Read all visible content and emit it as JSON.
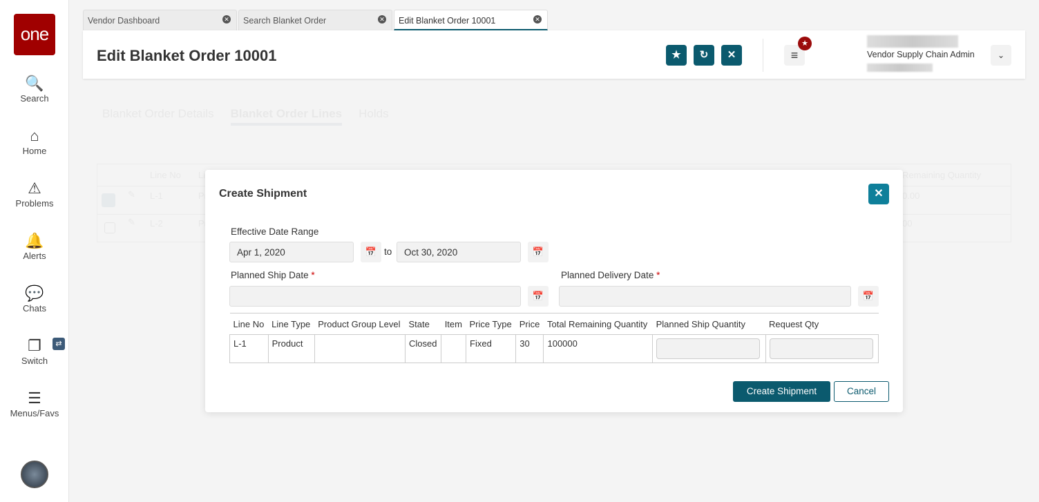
{
  "sidebar": {
    "logo": "one",
    "items": [
      {
        "label": "Search",
        "icon": "search-icon"
      },
      {
        "label": "Home",
        "icon": "home-icon"
      },
      {
        "label": "Problems",
        "icon": "warning-icon"
      },
      {
        "label": "Alerts",
        "icon": "bell-icon"
      },
      {
        "label": "Chats",
        "icon": "chat-icon"
      },
      {
        "label": "Switch",
        "icon": "switch-icon"
      },
      {
        "label": "Menus/Favs",
        "icon": "menu-icon"
      }
    ]
  },
  "tabs": [
    {
      "label": "Vendor Dashboard"
    },
    {
      "label": "Search Blanket Order"
    },
    {
      "label": "Edit Blanket Order 10001",
      "active": true
    }
  ],
  "header": {
    "title": "Edit Blanket Order 10001",
    "role": "Vendor Supply Chain Admin"
  },
  "background": {
    "tabs": [
      "Blanket Order Details",
      "Blanket Order Lines",
      "Holds"
    ],
    "table": {
      "headers": [
        "Line No",
        "Li",
        "Remaining Quantity"
      ],
      "rows": [
        [
          "L-1",
          "Pr",
          "0.00"
        ],
        [
          "L-2",
          "Pr",
          "00"
        ]
      ]
    }
  },
  "modal": {
    "title": "Create Shipment",
    "effective_date_range_label": "Effective Date Range",
    "from_date": "Apr 1, 2020",
    "to_label": "to",
    "to_date": "Oct 30, 2020",
    "planned_ship_date_label": "Planned Ship Date",
    "planned_delivery_date_label": "Planned Delivery Date",
    "required_mark": "*",
    "planned_ship_date": "",
    "planned_delivery_date": "",
    "table": {
      "headers": [
        "Line No",
        "Line Type",
        "Product Group Level",
        "State",
        "Item",
        "Price Type",
        "Price",
        "Total Remaining Quantity",
        "Planned Ship Quantity",
        "Request Qty"
      ],
      "rows": [
        [
          "L-1",
          "Product",
          "",
          "Closed",
          "",
          "Fixed",
          "30",
          "100000",
          "",
          ""
        ]
      ]
    },
    "create_label": "Create Shipment",
    "cancel_label": "Cancel"
  },
  "colors": {
    "brand": "#a00000",
    "primary": "#0b5a6e",
    "close": "#0e7f9a",
    "badge": "#9b0b0b"
  }
}
